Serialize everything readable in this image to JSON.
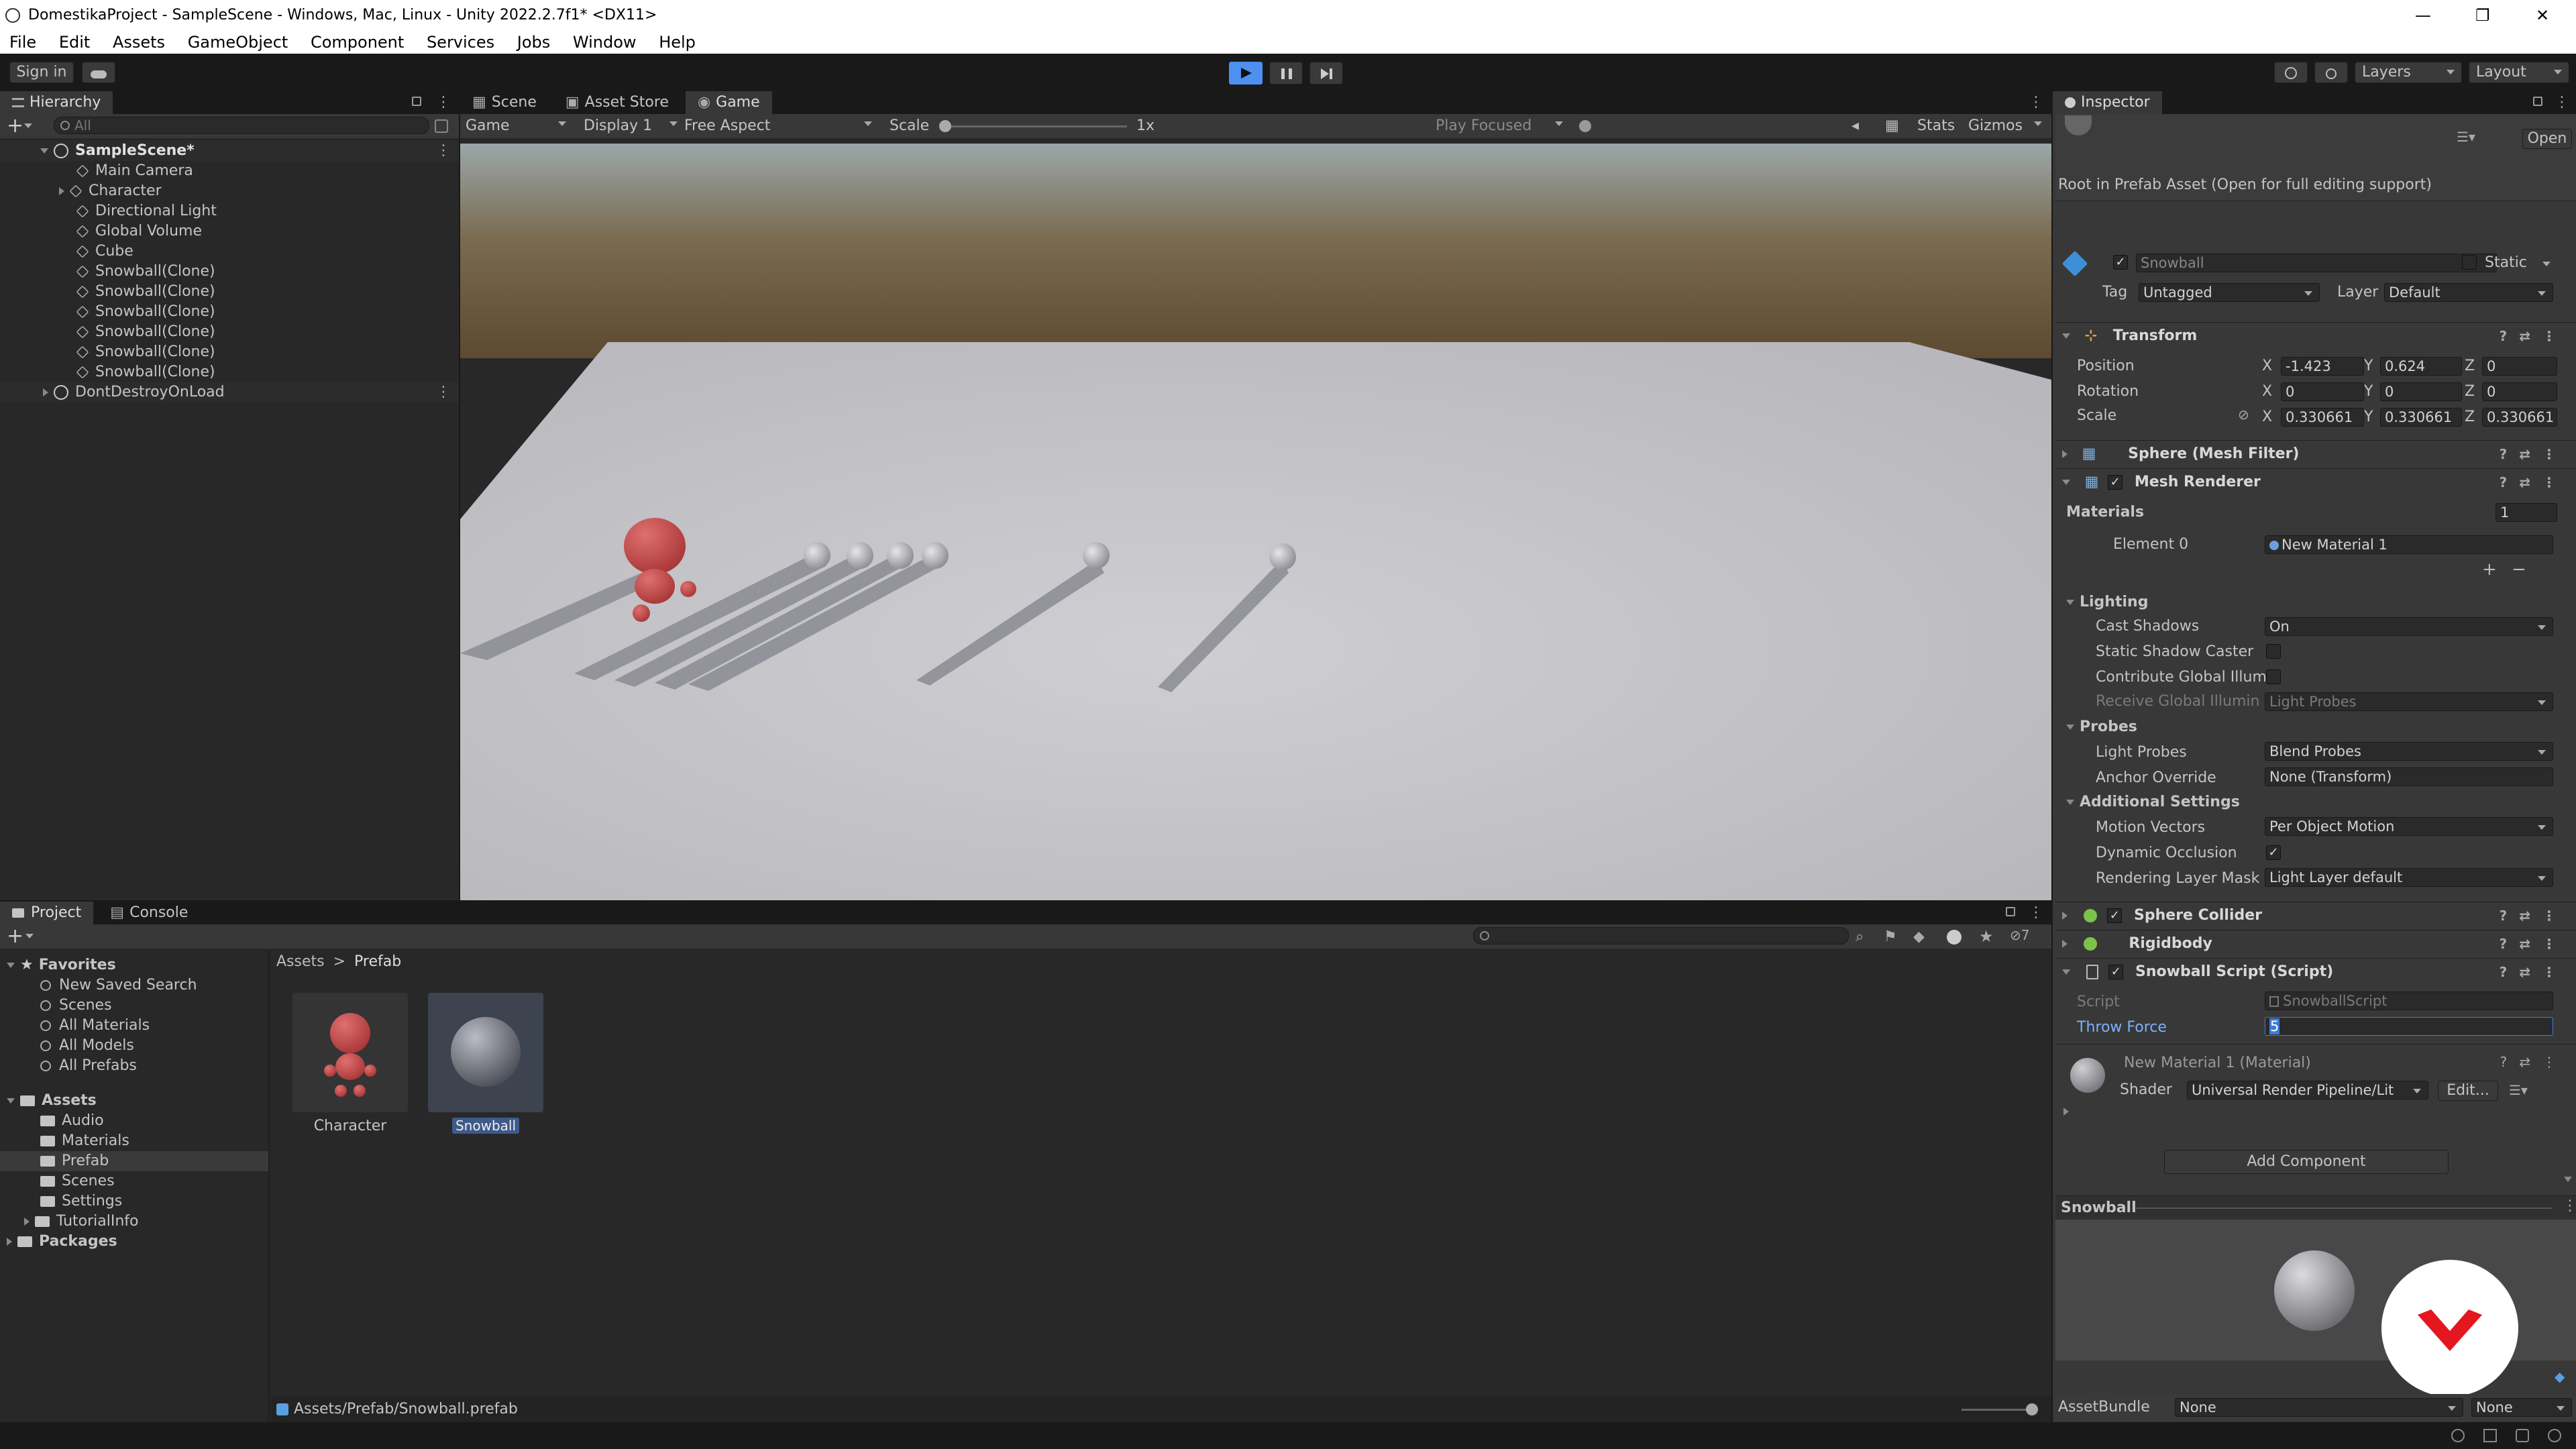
{
  "window": {
    "title": "DomestikaProject - SampleScene - Windows, Mac, Linux - Unity 2022.2.7f1* <DX11>",
    "minimize": "—",
    "maximize": "❐",
    "close": "✕"
  },
  "menu": [
    "File",
    "Edit",
    "Assets",
    "GameObject",
    "Component",
    "Services",
    "Jobs",
    "Window",
    "Help"
  ],
  "toolbar": {
    "sign_in": "Sign in",
    "layers": "Layers",
    "layout": "Layout"
  },
  "hierarchy": {
    "tab": "Hierarchy",
    "search_placeholder": "All",
    "scene": "SampleScene*",
    "items": [
      "Main Camera",
      "Character",
      "Directional Light",
      "Global Volume",
      "Cube",
      "Snowball(Clone)",
      "Snowball(Clone)",
      "Snowball(Clone)",
      "Snowball(Clone)",
      "Snowball(Clone)",
      "Snowball(Clone)"
    ],
    "dont_destroy": "DontDestroyOnLoad"
  },
  "view_tabs": [
    "Scene",
    "Asset Store",
    "Game"
  ],
  "game_toolbar": {
    "mode": "Game",
    "display": "Display 1",
    "aspect": "Free Aspect",
    "scale_label": "Scale",
    "scale_value": "1x",
    "play_focused": "Play Focused",
    "stats": "Stats",
    "gizmos": "Gizmos"
  },
  "project": {
    "tabs": [
      "Project",
      "Console"
    ],
    "favorites_label": "Favorites",
    "favorites": [
      "New Saved Search",
      "Scenes",
      "All Materials",
      "All Models",
      "All Prefabs"
    ],
    "assets_label": "Assets",
    "assets": [
      "Audio",
      "Materials",
      "Prefab",
      "Scenes",
      "Settings",
      "TutorialInfo"
    ],
    "packages_label": "Packages",
    "breadcrumb_root": "Assets",
    "breadcrumb_sep": ">",
    "breadcrumb_current": "Prefab",
    "grid_items": [
      "Character",
      "Snowball"
    ],
    "status_path": "Assets/Prefab/Snowball.prefab",
    "hidden_count": "7"
  },
  "inspector": {
    "tab": "Inspector",
    "open_button": "Open",
    "root_note": "Root in Prefab Asset (Open for full editing support)",
    "name": "Snowball",
    "static_label": "Static",
    "tag_label": "Tag",
    "tag_value": "Untagged",
    "layer_label": "Layer",
    "layer_value": "Default",
    "transform": {
      "title": "Transform",
      "position_label": "Position",
      "position": [
        "-1.423",
        "0.624",
        "0"
      ],
      "rotation_label": "Rotation",
      "rotation": [
        "0",
        "0",
        "0"
      ],
      "scale_label": "Scale",
      "scale": [
        "0.330661",
        "0.330661",
        "0.330661"
      ],
      "axes": [
        "X",
        "Y",
        "Z"
      ]
    },
    "mesh_filter": "Sphere (Mesh Filter)",
    "mesh_renderer": {
      "title": "Mesh Renderer",
      "materials_label": "Materials",
      "materials_count": "1",
      "element0_label": "Element 0",
      "element0_value": "New Material 1",
      "lighting_label": "Lighting",
      "cast_shadows_label": "Cast Shadows",
      "cast_shadows_value": "On",
      "static_shadow_label": "Static Shadow Caster",
      "contribute_gi_label": "Contribute Global Illum",
      "receive_gi_label": "Receive Global Illumin",
      "receive_gi_value": "Light Probes",
      "probes_label": "Probes",
      "light_probes_label": "Light Probes",
      "light_probes_value": "Blend Probes",
      "anchor_label": "Anchor Override",
      "anchor_value": "None (Transform)",
      "additional_label": "Additional Settings",
      "motion_label": "Motion Vectors",
      "motion_value": "Per Object Motion",
      "dynamic_occ_label": "Dynamic Occlusion",
      "rlm_label": "Rendering Layer Mask",
      "rlm_value": "Light Layer default"
    },
    "sphere_collider": "Sphere Collider",
    "rigidbody": "Rigidbody",
    "script": {
      "title": "Snowball Script (Script)",
      "script_label": "Script",
      "script_value": "SnowballScript",
      "throw_label": "Throw Force",
      "throw_value": "5"
    },
    "material": {
      "title": "New Material 1 (Material)",
      "shader_label": "Shader",
      "shader_value": "Universal Render Pipeline/Lit",
      "edit_button": "Edit..."
    },
    "add_component": "Add Component",
    "preview_title": "Snowball",
    "assetbundle_label": "AssetBundle",
    "assetbundle_value": "None",
    "assetbundle_variant": "None"
  },
  "colors": {
    "accent": "#3d7bd9",
    "play_active": "#4d90f0",
    "character": "#c84a4a",
    "floor": "#c8c8cc",
    "throw_label": "#7fb0ff"
  }
}
